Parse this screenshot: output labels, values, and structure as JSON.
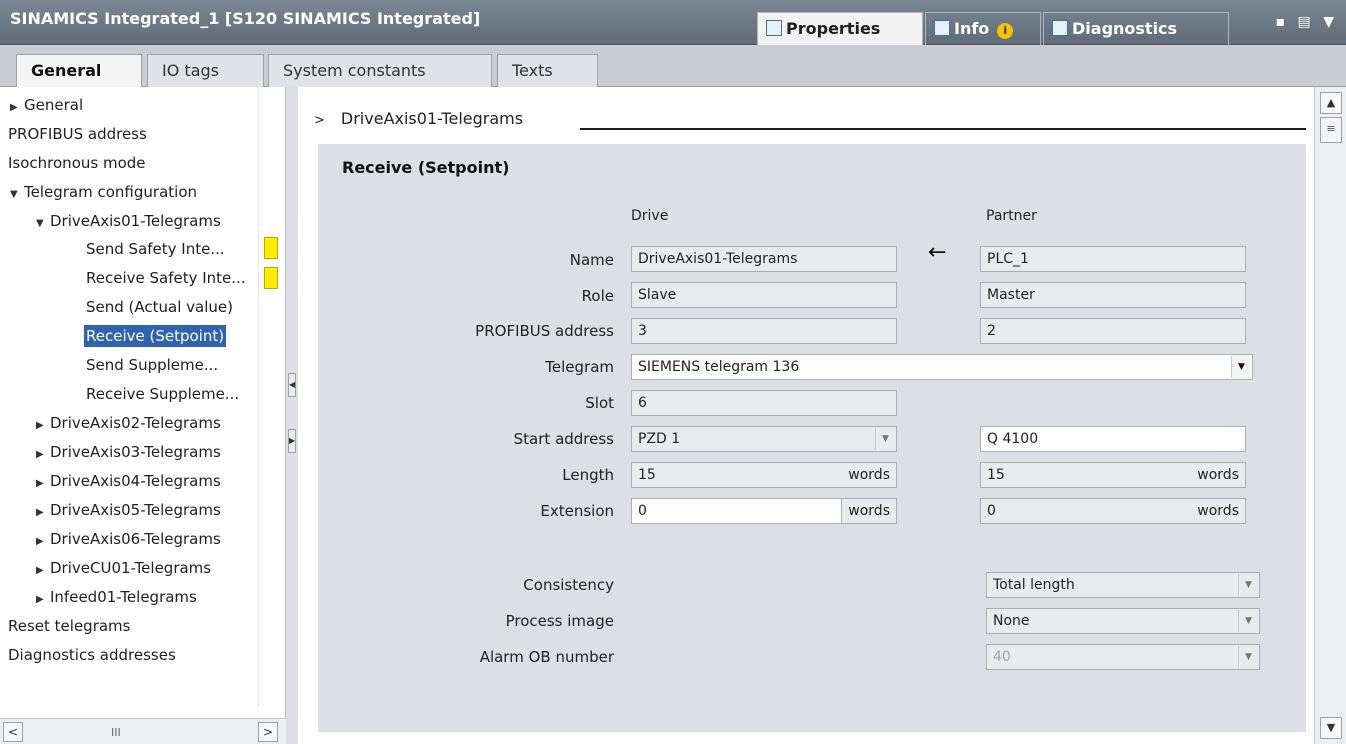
{
  "window": {
    "title": "SINAMICS Integrated_1 [S120 SINAMICS Integrated]",
    "tabs": [
      {
        "label": "Properties",
        "icon": "properties-icon"
      },
      {
        "label": "Info",
        "icon": "info-icon",
        "badge": "i"
      },
      {
        "label": "Diagnostics",
        "icon": "diagnostics-icon"
      }
    ],
    "controls": "▪ ▤ ▼"
  },
  "subtabs": [
    "General",
    "IO tags",
    "System constants",
    "Texts"
  ],
  "nav": {
    "items": [
      {
        "label": "General",
        "arrow": "▶"
      },
      {
        "label": "PROFIBUS address",
        "arrow": ""
      },
      {
        "label": "Isochronous mode",
        "arrow": ""
      },
      {
        "label": "Telegram configuration",
        "arrow": "▼"
      },
      {
        "label": "DriveAxis01-Telegrams",
        "arrow": "▼"
      },
      {
        "label": "Send Safety Inte...",
        "arrow": ""
      },
      {
        "label": "Receive Safety Inte...",
        "arrow": ""
      },
      {
        "label": "Send (Actual value)",
        "arrow": ""
      },
      {
        "label": "Receive (Setpoint)",
        "arrow": ""
      },
      {
        "label": "Send Suppleme...",
        "arrow": ""
      },
      {
        "label": "Receive Suppleme...",
        "arrow": ""
      },
      {
        "label": "DriveAxis02-Telegrams",
        "arrow": "▶"
      },
      {
        "label": "DriveAxis03-Telegrams",
        "arrow": "▶"
      },
      {
        "label": "DriveAxis04-Telegrams",
        "arrow": "▶"
      },
      {
        "label": "DriveAxis05-Telegrams",
        "arrow": "▶"
      },
      {
        "label": "DriveAxis06-Telegrams",
        "arrow": "▶"
      },
      {
        "label": "DriveCU01-Telegrams",
        "arrow": "▶"
      },
      {
        "label": "Infeed01-Telegrams",
        "arrow": "▶"
      },
      {
        "label": "Reset telegrams",
        "arrow": ""
      },
      {
        "label": "Diagnostics addresses",
        "arrow": ""
      }
    ],
    "selected": "Receive (Setpoint)",
    "scroll_left": "<",
    "scroll_right": ">",
    "scroll_grip": "III"
  },
  "main": {
    "breadcrumb_arrow": ">",
    "breadcrumb": "DriveAxis01-Telegrams",
    "section_title": "Receive (Setpoint)",
    "col_drive": "Drive",
    "col_partner": "Partner",
    "labels": {
      "name": "Name",
      "role": "Role",
      "profibus": "PROFIBUS address",
      "telegram": "Telegram",
      "slot": "Slot",
      "start": "Start address",
      "length": "Length",
      "extension": "Extension",
      "consistency": "Consistency",
      "process_image": "Process image",
      "alarm_ob": "Alarm OB number"
    },
    "drive": {
      "name": "DriveAxis01-Telegrams",
      "role": "Slave",
      "profibus": "3",
      "telegram": "SIEMENS telegram 136",
      "slot": "6",
      "start": "PZD 1",
      "length": "15",
      "extension": "0"
    },
    "partner": {
      "name": "PLC_1",
      "role": "Master",
      "profibus": "2",
      "start": "Q 4100",
      "length": "15",
      "extension": "0",
      "consistency": "Total length",
      "process_image": "None",
      "alarm_ob": "40"
    },
    "unit": "words",
    "arrow": "←"
  },
  "scroll": {
    "up": "▲",
    "down": "▼",
    "thumb": "≡"
  }
}
